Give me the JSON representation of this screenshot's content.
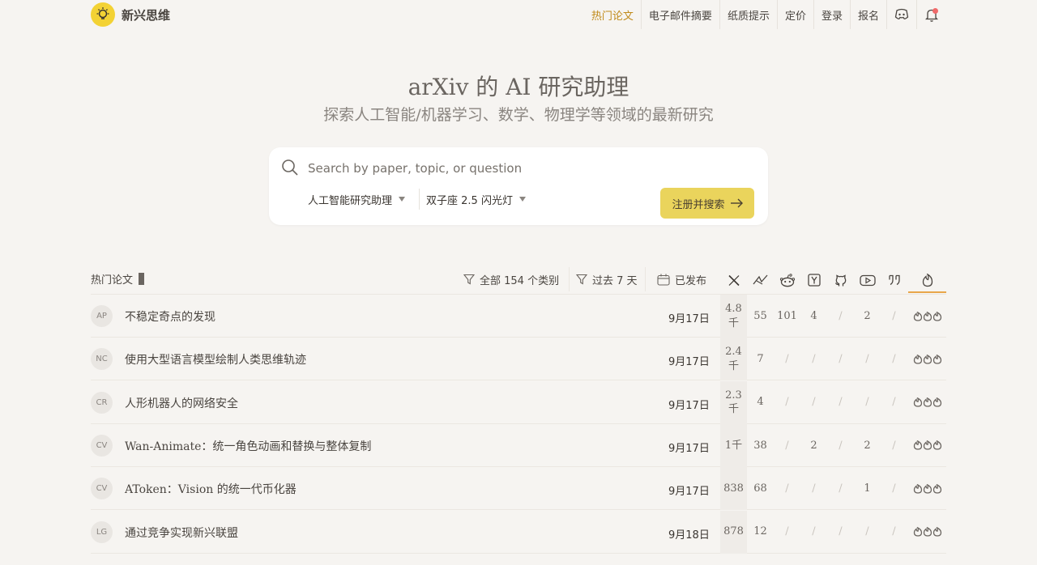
{
  "brand": {
    "name": "新兴思维"
  },
  "nav": {
    "items": [
      "热门论文",
      "电子邮件摘要",
      "纸质提示",
      "定价",
      "登录",
      "报名"
    ],
    "active_index": 0
  },
  "hero": {
    "title": "arXiv 的 AI 研究助理",
    "subtitle": "探索人工智能/机器学习、数学、物理学等领域的最新研究"
  },
  "search": {
    "placeholder": "Search by paper, topic, or question",
    "assistant_select": "人工智能研究助理",
    "model_select": "双子座 2.5 闪光灯",
    "submit_label": "注册并搜索"
  },
  "table": {
    "section_title": "热门论文",
    "filter_categories": "全部 154 个类别",
    "filter_time": "过去 7 天",
    "filter_published": "已发布",
    "columns": [
      "x-icon",
      "alphaxiv-icon",
      "reddit-icon",
      "hackernews-icon",
      "github-icon",
      "youtube-icon",
      "quote-icon",
      "hot-icon"
    ],
    "rows": [
      {
        "cat": "AP",
        "title": "不稳定奇点的发现",
        "date": "9月17日",
        "stats": [
          "4.8\n千",
          "55",
          "101",
          "4",
          "/",
          "2",
          "/"
        ]
      },
      {
        "cat": "NC",
        "title": "使用大型语言模型绘制人类思维轨迹",
        "date": "9月17日",
        "stats": [
          "2.4\n千",
          "7",
          "/",
          "/",
          "/",
          "/",
          "/"
        ]
      },
      {
        "cat": "CR",
        "title": "人形机器人的网络安全",
        "date": "9月17日",
        "stats": [
          "2.3\n千",
          "4",
          "/",
          "/",
          "/",
          "/",
          "/"
        ]
      },
      {
        "cat": "CV",
        "title": "Wan-Animate：统一角色动画和替换与整体复制",
        "date": "9月17日",
        "stats": [
          "1千",
          "38",
          "/",
          "2",
          "/",
          "2",
          "/"
        ]
      },
      {
        "cat": "CV",
        "title": "AToken：Vision 的统一代币化器",
        "date": "9月17日",
        "stats": [
          "838",
          "68",
          "/",
          "/",
          "/",
          "1",
          "/"
        ]
      },
      {
        "cat": "LG",
        "title": "通过竞争实现新兴联盟",
        "date": "9月18日",
        "stats": [
          "878",
          "12",
          "/",
          "/",
          "/",
          "/",
          "/"
        ]
      }
    ]
  },
  "colors": {
    "accent": "#c08a1a",
    "button": "#ead45c",
    "logo": "#f3d234",
    "active_tab": "#e8a64a"
  }
}
